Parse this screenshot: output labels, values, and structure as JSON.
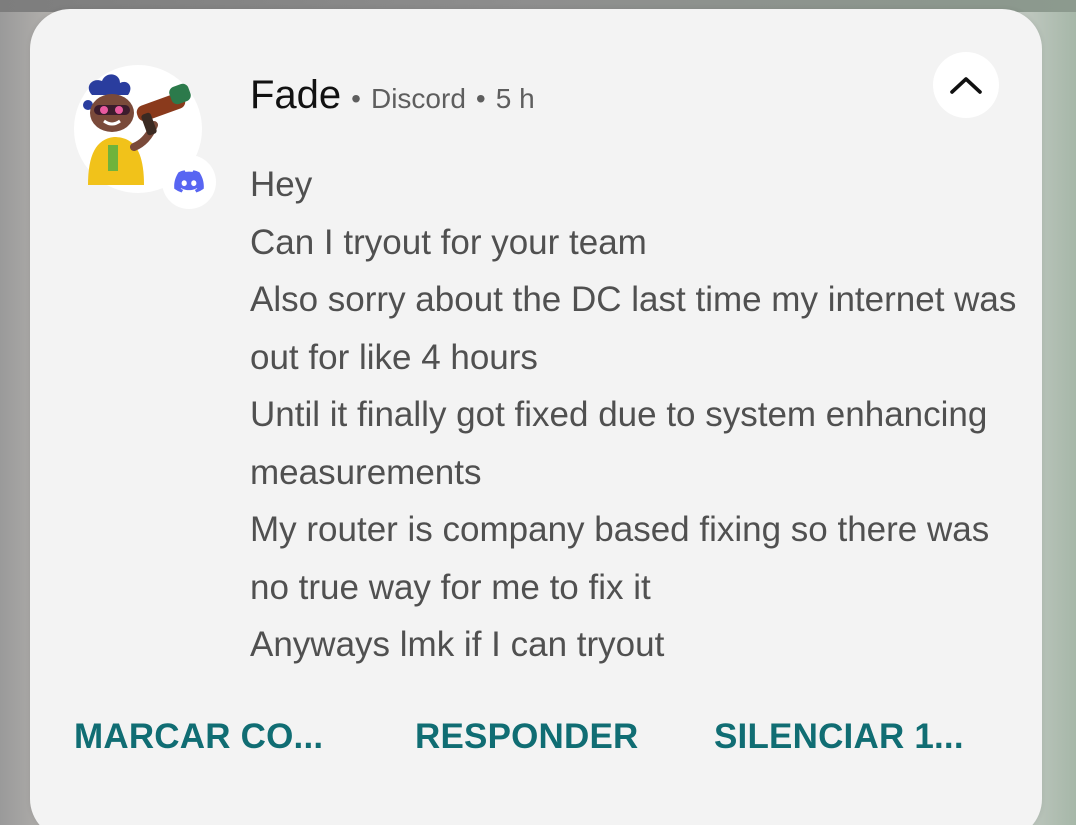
{
  "notification": {
    "sender": "Fade",
    "app_name": "Discord",
    "time": "5 h",
    "separator": "•",
    "avatar_icon": "game-character-avatar",
    "app_badge_icon": "discord-icon",
    "collapse_icon": "chevron-up-icon",
    "messages": [
      "Hey",
      "Can I tryout for your team",
      "Also sorry about the DC last time my internet was out for like 4 hours",
      "Until it finally got fixed due to system enhancing measurements",
      "My router is company based fixing so there was no true way for me to fix it",
      "Anyways lmk if I can tryout"
    ],
    "actions": {
      "mark_read": "MARCAR CO...",
      "reply": "RESPONDER",
      "mute": "SILENCIAR 1..."
    }
  },
  "colors": {
    "card_background": "#f3f3f3",
    "action_text": "#106d73",
    "discord_blurple": "#5865f2",
    "sender_text": "#111111",
    "message_text": "#505050"
  }
}
